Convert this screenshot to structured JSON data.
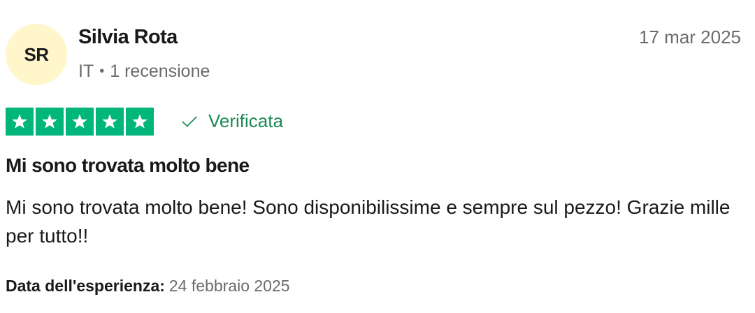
{
  "author": {
    "initials": "SR",
    "name": "Silvia Rota",
    "country": "IT",
    "separator": "•",
    "review_count": "1 recensione"
  },
  "review": {
    "date": "17 mar 2025",
    "rating": 5,
    "rating_max": 5,
    "verified_label": "Verificata",
    "title": "Mi sono trovata molto bene",
    "body": "Mi sono trovata molto bene! Sono disponibilissime e sempre sul pezzo! Grazie mille per tutto!!",
    "experience_label": "Data dell'esperienza:",
    "experience_date": "24 febbraio 2025"
  },
  "colors": {
    "star_green": "#00b67a",
    "verified_green": "#1b8a55",
    "avatar_bg": "#fff6cc",
    "muted_text": "#6b6b6b"
  },
  "icons": {
    "star": "star-icon",
    "verified": "checkmark-icon"
  }
}
